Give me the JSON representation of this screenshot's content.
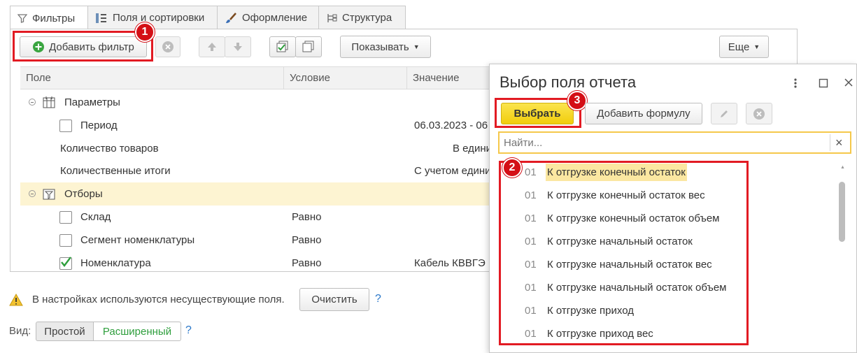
{
  "tabs": [
    {
      "label": "Фильтры",
      "icon": "funnel-icon"
    },
    {
      "label": "Поля и сортировки",
      "icon": "fields-icon"
    },
    {
      "label": "Оформление",
      "icon": "brush-icon"
    },
    {
      "label": "Структура",
      "icon": "tree-icon"
    }
  ],
  "toolbar": {
    "add_filter": "Добавить фильтр",
    "show": "Показывать",
    "more": "Еще"
  },
  "table": {
    "columns": [
      "Поле",
      "Условие",
      "Значение"
    ],
    "rows": [
      {
        "field": "Параметры",
        "condition": "",
        "value": ""
      },
      {
        "field": "Период",
        "condition": "",
        "value": "06.03.2023 - 06"
      },
      {
        "field": "Количество товаров",
        "condition": "",
        "value": "В едини"
      },
      {
        "field": "Количественные итоги",
        "condition": "",
        "value": "С учетом едини"
      },
      {
        "field": "Отборы",
        "condition": "",
        "value": ""
      },
      {
        "field": "Склад",
        "condition": "Равно",
        "value": ""
      },
      {
        "field": "Сегмент номенклатуры",
        "condition": "Равно",
        "value": ""
      },
      {
        "field": "Номенклатура",
        "condition": "Равно",
        "value": "Кабель КВВГЭ"
      }
    ]
  },
  "warning": {
    "text": "В настройках используются несуществующие поля.",
    "clear": "Очистить",
    "help": "?"
  },
  "view": {
    "label": "Вид:",
    "simple": "Простой",
    "extended": "Расширенный",
    "help": "?"
  },
  "dialog": {
    "title": "Выбор поля отчета",
    "select": "Выбрать",
    "add_formula": "Добавить формулу",
    "search_placeholder": "Найти...",
    "clear_search": "×",
    "items": [
      {
        "num": "01",
        "label": "К отгрузке конечный остаток"
      },
      {
        "num": "01",
        "label": "К отгрузке конечный остаток вес"
      },
      {
        "num": "01",
        "label": "К отгрузке конечный остаток объем"
      },
      {
        "num": "01",
        "label": "К отгрузке начальный остаток"
      },
      {
        "num": "01",
        "label": "К отгрузке начальный остаток вес"
      },
      {
        "num": "01",
        "label": "К отгрузке начальный остаток объем"
      },
      {
        "num": "01",
        "label": "К отгрузке приход"
      },
      {
        "num": "01",
        "label": "К отгрузке приход вес"
      }
    ]
  },
  "badges": [
    "1",
    "2",
    "3"
  ],
  "colors": {
    "accent_red": "#e21b23",
    "select_yellow": "#f5d312",
    "highlight_row": "#fdf4d2",
    "green": "#2e9e3c"
  }
}
